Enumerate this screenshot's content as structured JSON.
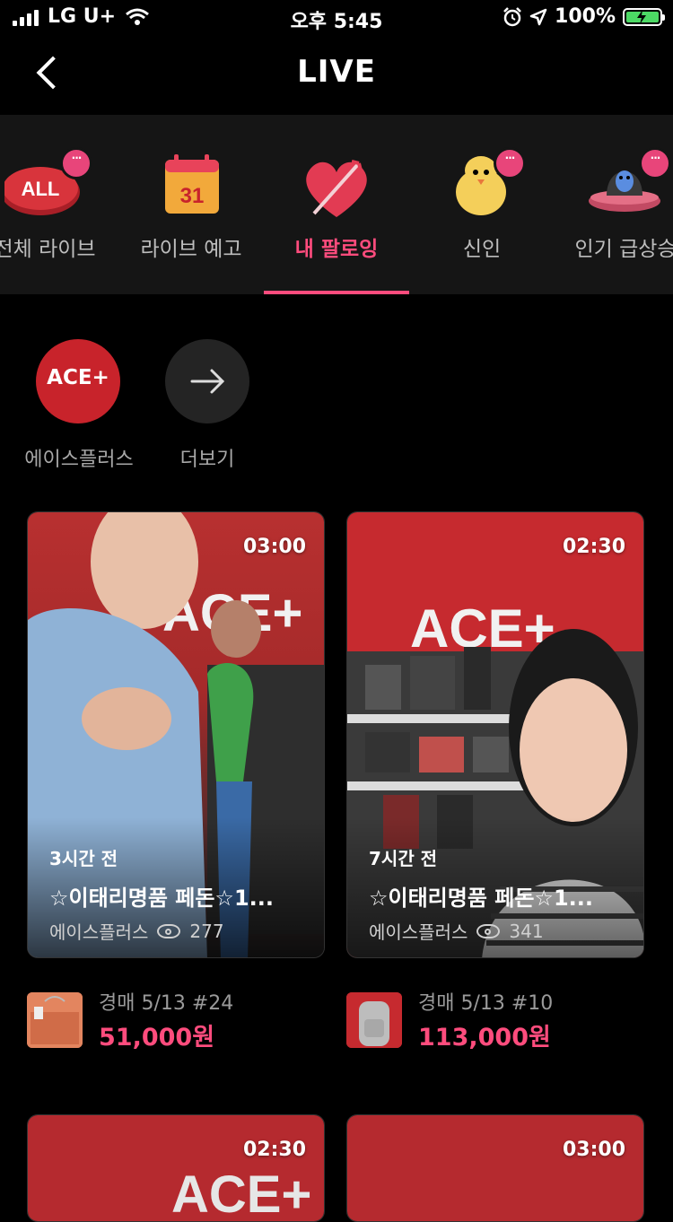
{
  "status_bar": {
    "carrier": "LG U+",
    "time": "오후 5:45",
    "battery": "100%"
  },
  "header": {
    "title": "LIVE"
  },
  "tabs": [
    {
      "label": "전체 라이브",
      "icon": "all-icon"
    },
    {
      "label": "라이브 예고",
      "icon": "calendar-icon",
      "date": "31"
    },
    {
      "label": "내 팔로잉",
      "icon": "heart-arrow-icon",
      "active": true
    },
    {
      "label": "신인",
      "icon": "chick-icon"
    },
    {
      "label": "인기 급상승",
      "icon": "ufo-icon"
    }
  ],
  "all_badge": "ALL",
  "following": [
    {
      "name": "에이스플러스",
      "logo": "ACE+"
    },
    {
      "name": "더보기"
    }
  ],
  "cards": [
    {
      "duration": "03:00",
      "ago": "3시간 전",
      "title": "☆이태리명품 페돈☆1...",
      "seller": "에이스플러스",
      "views": "277",
      "auction_label": "경매 5/13 #24",
      "price": "51,000원"
    },
    {
      "duration": "02:30",
      "ago": "7시간 전",
      "title": "☆이태리명품 페돈☆1...",
      "seller": "에이스플러스",
      "views": "341",
      "auction_label": "경매 5/13 #10",
      "price": "113,000원"
    },
    {
      "duration": "02:30"
    },
    {
      "duration": "03:00"
    }
  ],
  "colors": {
    "accent": "#ff4c7d",
    "brand_red": "#c8232b",
    "background": "#000000"
  }
}
